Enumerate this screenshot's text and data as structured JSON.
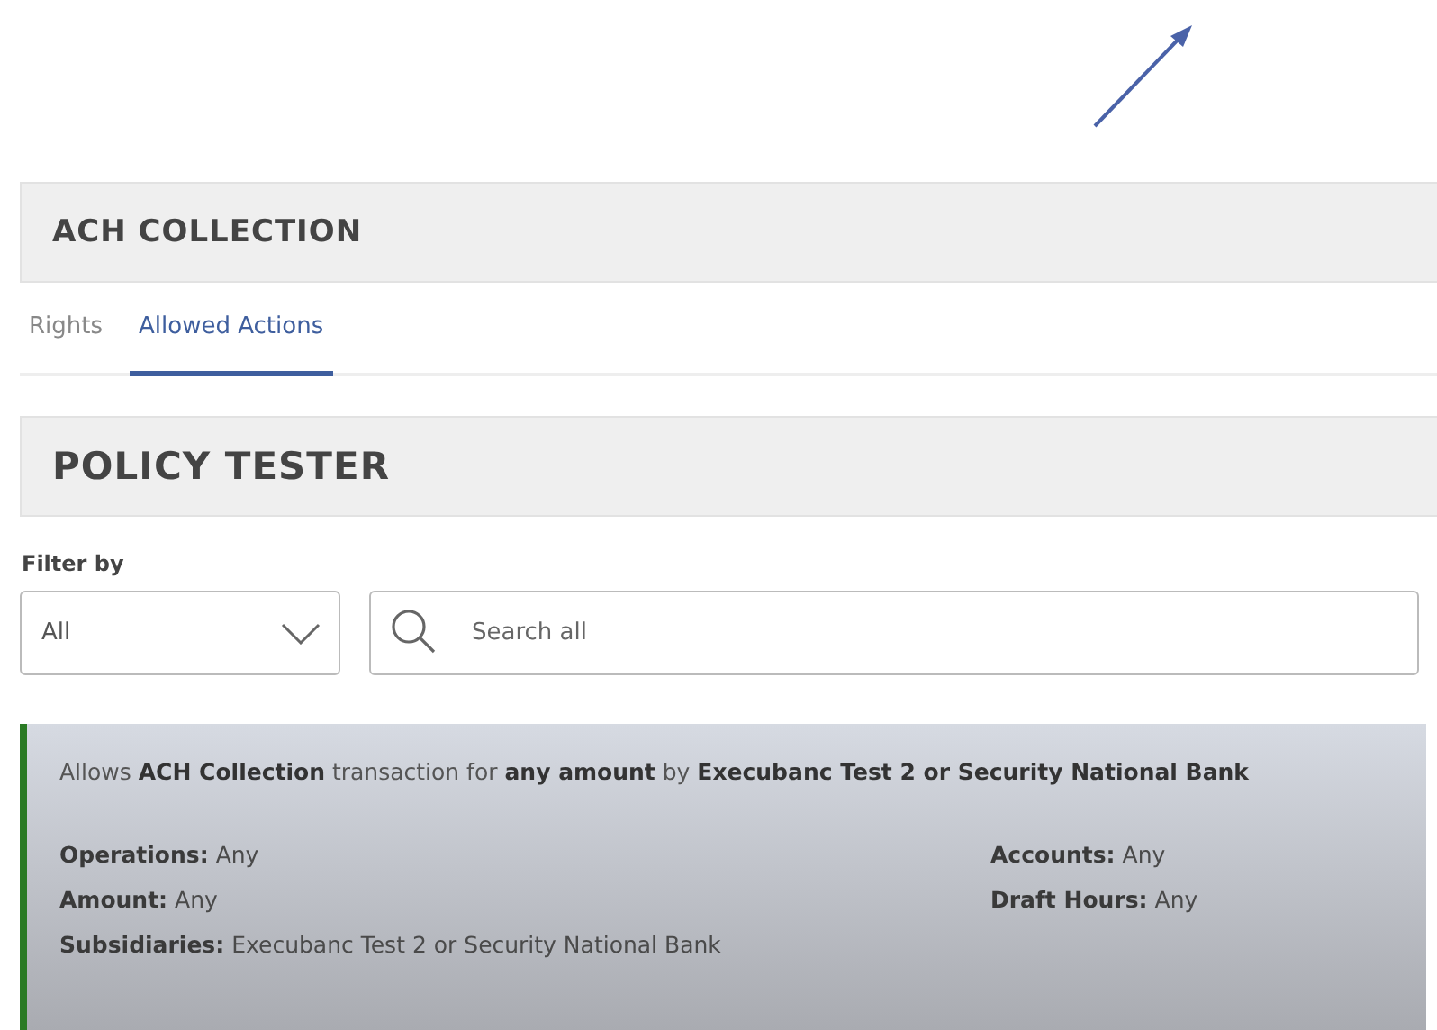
{
  "section_title": "ACH COLLECTION",
  "tabs": [
    {
      "label": "Rights",
      "selected": false
    },
    {
      "label": "Allowed Actions",
      "selected": true
    }
  ],
  "tester_title": "POLICY TESTER",
  "filter": {
    "label": "Filter by",
    "value": "All"
  },
  "search": {
    "placeholder": "Search all"
  },
  "policy": {
    "summary": "Allows **ACH Collection** transaction for **any amount** by **Execubanc Test 2 or Security National Bank**",
    "left": [
      {
        "label": "Operations:",
        "value": "Any"
      },
      {
        "label": "Amount:",
        "value": "Any"
      },
      {
        "label": "Subsidiaries:",
        "value": "Execubanc Test 2 or Security National Bank"
      }
    ],
    "right": [
      {
        "label": "Accounts:",
        "value": "Any"
      },
      {
        "label": "Draft Hours:",
        "value": "Any"
      }
    ]
  }
}
